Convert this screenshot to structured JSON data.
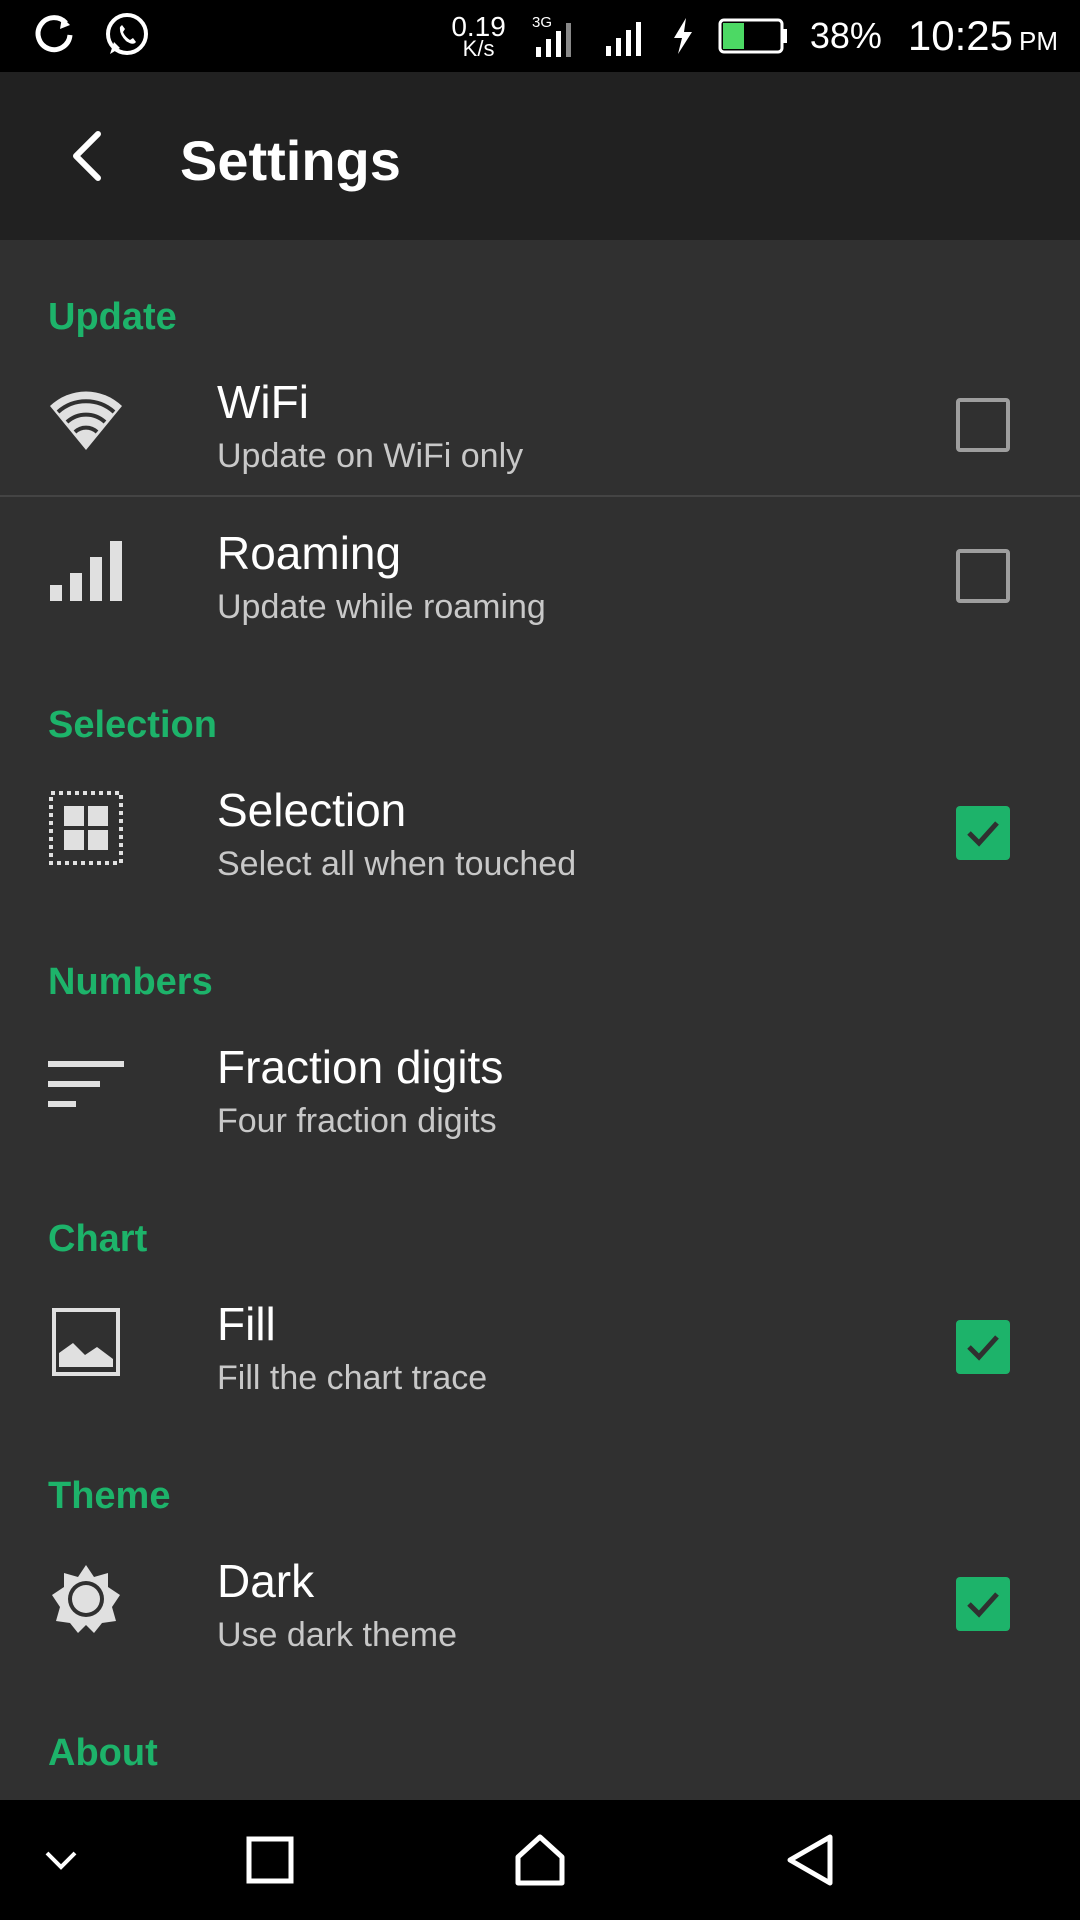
{
  "status_bar": {
    "net_speed_value": "0.19",
    "net_speed_unit": "K/s",
    "network_type": "3G",
    "battery_percent": "38%",
    "time": "10:25",
    "ampm": "PM",
    "battery_level": 0.38,
    "icons": [
      "refresh-icon",
      "whatsapp-icon",
      "signal-3g-icon",
      "signal-icon",
      "charging-icon",
      "battery-icon"
    ]
  },
  "app_bar": {
    "title": "Settings",
    "back_icon": "back-arrow-icon"
  },
  "sections": {
    "update": "Update",
    "selection": "Selection",
    "numbers": "Numbers",
    "chart": "Chart",
    "theme": "Theme",
    "about": "About"
  },
  "rows": {
    "wifi": {
      "primary": "WiFi",
      "secondary": "Update on WiFi only",
      "checked": false,
      "icon": "wifi-icon"
    },
    "roaming": {
      "primary": "Roaming",
      "secondary": "Update while roaming",
      "checked": false,
      "icon": "signal-bars-icon"
    },
    "selection": {
      "primary": "Selection",
      "secondary": "Select all when touched",
      "checked": true,
      "icon": "select-all-icon"
    },
    "fraction": {
      "primary": "Fraction digits",
      "secondary": "Four fraction digits",
      "icon": "sort-lines-icon"
    },
    "fill": {
      "primary": "Fill",
      "secondary": "Fill the chart trace",
      "checked": true,
      "icon": "image-icon"
    },
    "dark": {
      "primary": "Dark",
      "secondary": "Use dark theme",
      "checked": true,
      "icon": "brightness-icon"
    }
  },
  "colors": {
    "accent": "#1db36a",
    "background": "#303030",
    "app_bar": "#212121"
  },
  "nav_bar": {
    "icons": [
      "chevron-down-icon",
      "recents-icon",
      "home-icon",
      "back-triangle-icon"
    ]
  }
}
